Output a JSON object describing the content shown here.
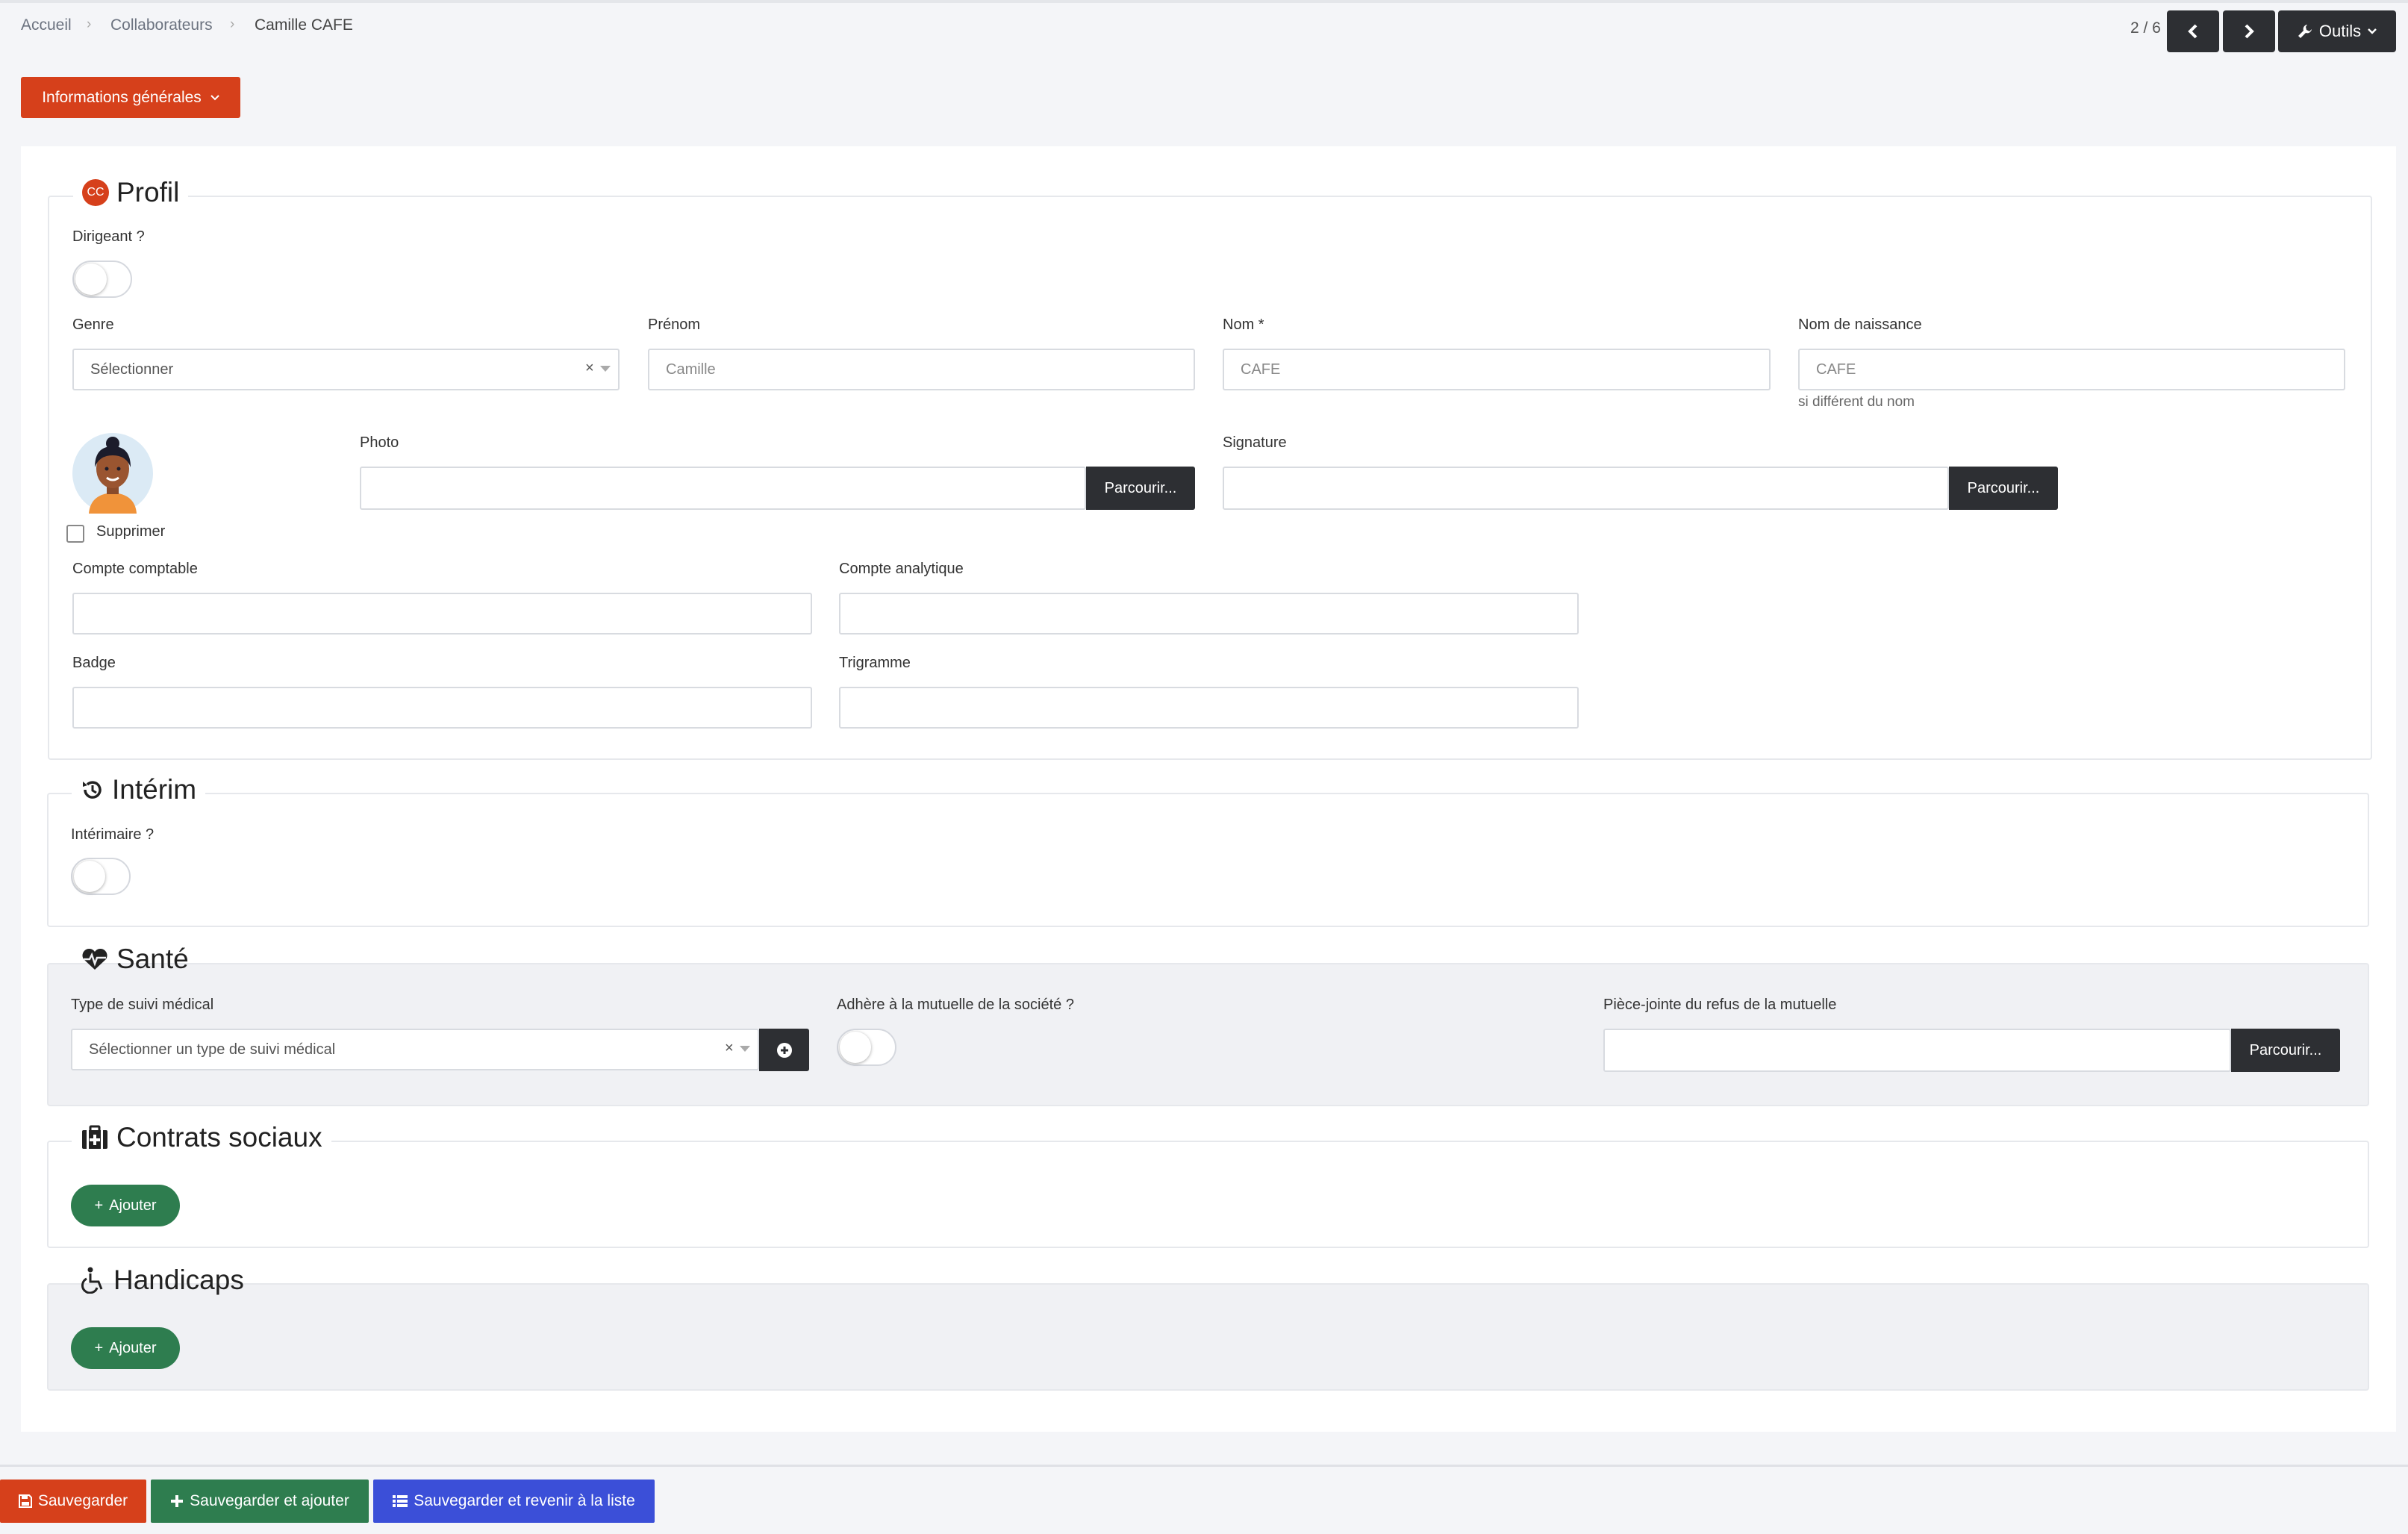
{
  "breadcrumb": {
    "home": "Accueil",
    "section": "Collaborateurs",
    "current": "Camille CAFE"
  },
  "pager": {
    "text": "2 / 6"
  },
  "tools": {
    "label": "Outils"
  },
  "info_menu": {
    "label": "Informations générales"
  },
  "profil": {
    "title": "Profil",
    "avatar_initials": "CC",
    "dirigeant_label": "Dirigeant ?",
    "genre_label": "Genre",
    "genre_value": "Sélectionner",
    "prenom_label": "Prénom",
    "prenom_value": "Camille",
    "nom_label": "Nom *",
    "nom_value": "CAFE",
    "naissance_label": "Nom de naissance",
    "naissance_value": "CAFE",
    "naissance_help": "si différent du nom",
    "photo_label": "Photo",
    "signature_label": "Signature",
    "browse_label": "Parcourir...",
    "supprimer_label": "Supprimer",
    "compte_comptable_label": "Compte comptable",
    "compte_analytique_label": "Compte analytique",
    "badge_label": "Badge",
    "trigramme_label": "Trigramme"
  },
  "interim": {
    "title": "Intérim",
    "interimaire_label": "Intérimaire ?"
  },
  "sante": {
    "title": "Santé",
    "suivi_label": "Type de suivi médical",
    "suivi_placeholder": "Sélectionner un type de suivi médical",
    "mutuelle_label": "Adhère à la mutuelle de la société ?",
    "refus_label": "Pièce-jointe du refus de la mutuelle",
    "browse_label": "Parcourir..."
  },
  "contrats": {
    "title": "Contrats sociaux",
    "add_label": "Ajouter"
  },
  "handicaps": {
    "title": "Handicaps",
    "add_label": "Ajouter"
  },
  "footer": {
    "save": "Sauvegarder",
    "save_add": "Sauvegarder et ajouter",
    "save_back": "Sauvegarder et revenir à la liste"
  },
  "colors": {
    "primary_orange": "#d6401b",
    "green": "#2e7d4f",
    "blue": "#3b4fd8",
    "dark": "#2d2f33"
  }
}
